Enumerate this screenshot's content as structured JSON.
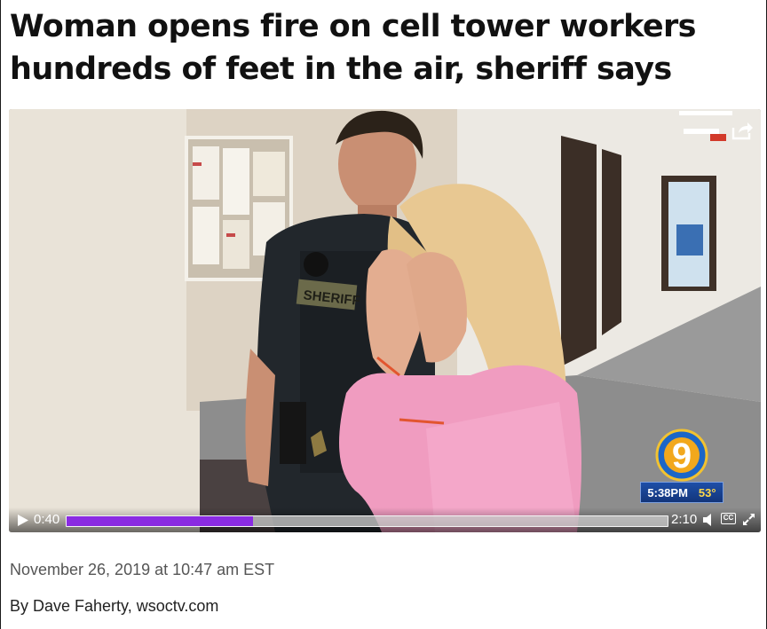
{
  "article": {
    "headline": "Woman opens fire on cell tower workers hundreds of feet in the air, sheriff says",
    "date": "November 26, 2019 at 10:47 am EST",
    "byline": "By Dave Faherty, wsoctv.com"
  },
  "video": {
    "current_time": "0:40",
    "duration": "2:10",
    "progress": 0.31,
    "badge_text": "SHERIFF",
    "station_logo_text": "9",
    "overlay_time": "5:38PM",
    "overlay_temp": "53°",
    "cc_label": "CC",
    "accent_color": "#8a2be2"
  },
  "icons": {
    "play": "play-icon",
    "volume": "volume-icon",
    "captions": "closed-captions-icon",
    "fullscreen": "fullscreen-icon",
    "share": "share-icon"
  }
}
